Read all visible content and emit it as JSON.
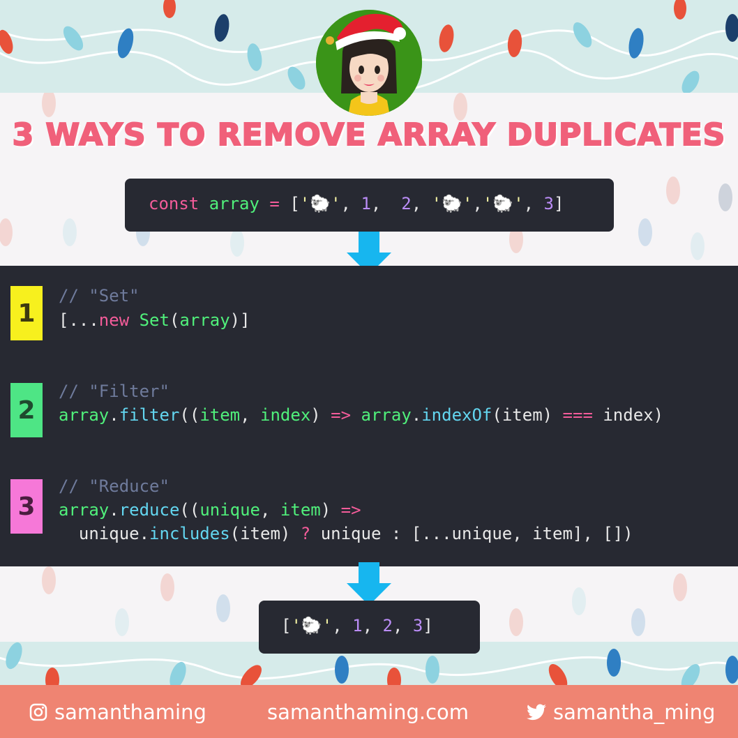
{
  "title": "3 WAYS TO REMOVE ARRAY DUPLICATES",
  "input_code": {
    "keyword": "const",
    "name": "array",
    "op": "=",
    "open": "[",
    "items": [
      {
        "type": "str",
        "text": "'🐑'"
      },
      {
        "type": "sep",
        "text": ", "
      },
      {
        "type": "num",
        "text": "1"
      },
      {
        "type": "sep",
        "text": ",  "
      },
      {
        "type": "num",
        "text": "2"
      },
      {
        "type": "sep",
        "text": ", "
      },
      {
        "type": "str",
        "text": "'🐑'"
      },
      {
        "type": "sep",
        "text": ","
      },
      {
        "type": "str",
        "text": "'🐑'"
      },
      {
        "type": "sep",
        "text": ", "
      },
      {
        "type": "num",
        "text": "3"
      }
    ],
    "close": "]"
  },
  "methods": [
    {
      "badge": "1",
      "comment": "// \"Set\""
    },
    {
      "badge": "2",
      "comment": "// \"Filter\""
    },
    {
      "badge": "3",
      "comment": "// \"Reduce\""
    }
  ],
  "code": {
    "set_open": "[...",
    "set_new": "new",
    "set_ctor": " Set",
    "set_paren_open": "(",
    "set_arg": "array",
    "set_close": ")]",
    "f_obj": "array",
    "f_dot": ".",
    "f_method": "filter",
    "f_open": "((",
    "f_p1": "item",
    "f_comma": ", ",
    "f_p2": "index",
    "f_close": ") ",
    "f_arrow": "=>",
    "f_sp": " ",
    "f_obj2": "array",
    "f_dot2": ".",
    "f_method2": "indexOf",
    "f_arg": "(item) ",
    "f_eq": "===",
    "f_end": " index)",
    "r_obj": "array",
    "r_dot": ".",
    "r_method": "reduce",
    "r_open": "((",
    "r_p1": "unique",
    "r_comma": ", ",
    "r_p2": "item",
    "r_close": ") ",
    "r_arrow": "=>",
    "r2_indent": "  unique",
    "r2_dot": ".",
    "r2_method": "includes",
    "r2_arg": "(item) ",
    "r2_q": "?",
    "r2_rest": " unique : [...unique, item], [])"
  },
  "output_code": {
    "open": "[",
    "s1": "'🐑'",
    "sep1": ", ",
    "n1": "1",
    "sep2": ", ",
    "n2": "2",
    "sep3": ", ",
    "n3": "3",
    "close": "]"
  },
  "footer": {
    "instagram": "samanthaming",
    "website": "samanthaming.com",
    "twitter": "samantha_ming"
  },
  "colors": {
    "title": "#f0607a",
    "panel": "#272932",
    "badge1": "#f7f01e",
    "badge2": "#4ee585",
    "badge3": "#f678d8",
    "arrow": "#17b6ef",
    "footer": "#ef8472"
  },
  "icons": [
    "instagram-icon",
    "twitter-icon",
    "down-arrow-icon",
    "sheep-emoji"
  ]
}
